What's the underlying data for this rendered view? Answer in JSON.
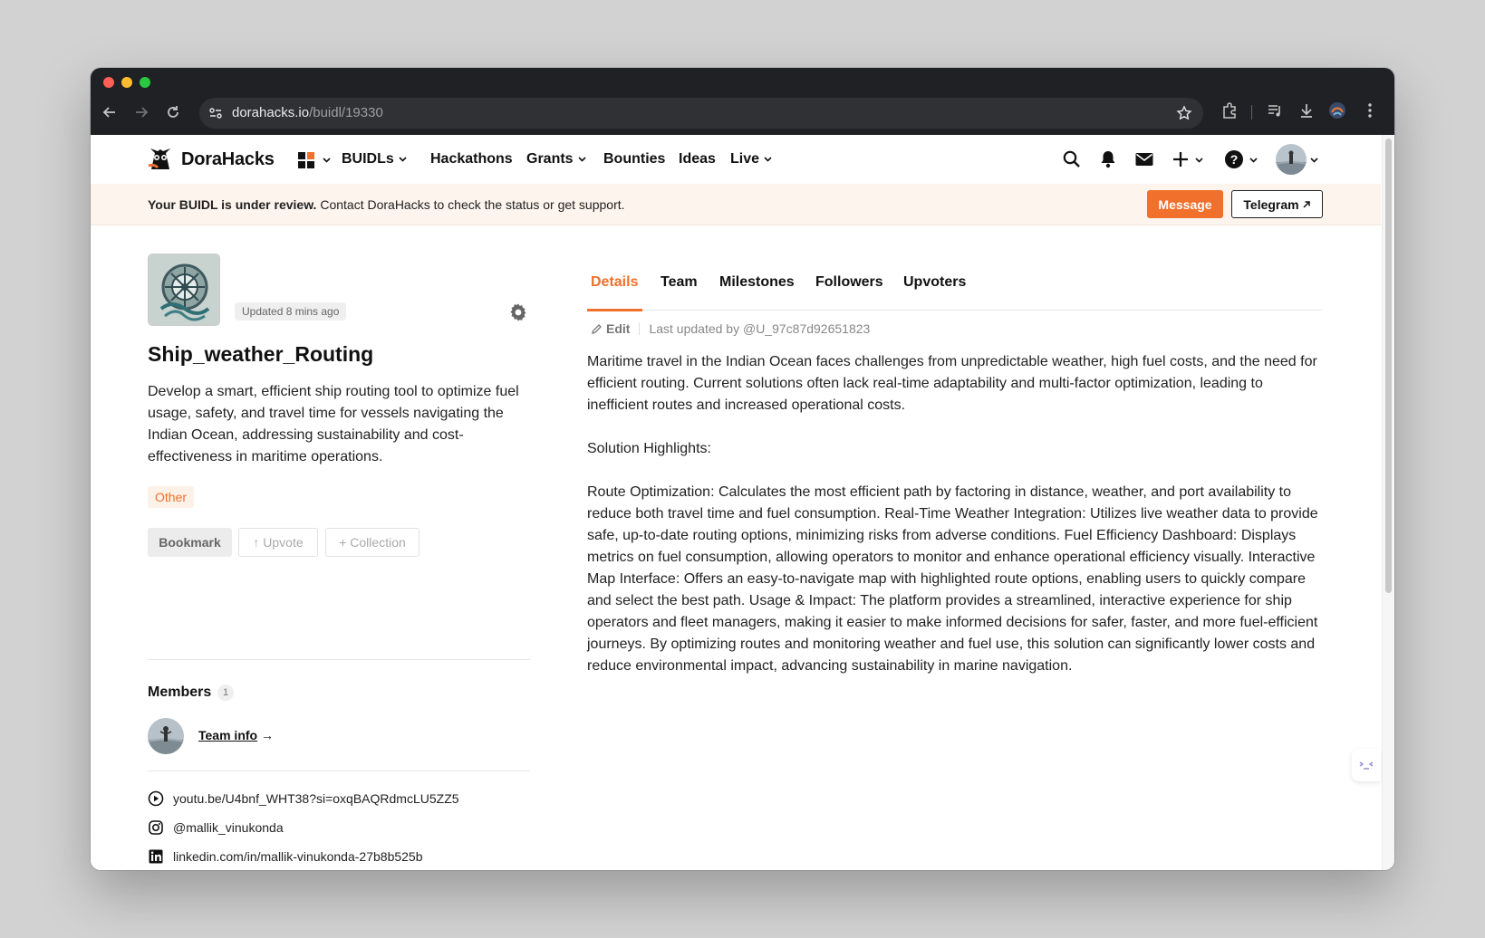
{
  "browser": {
    "url_host": "dorahacks.io",
    "url_path": "/buidl/19330"
  },
  "nav": {
    "brand": "DoraHacks",
    "buidls": "BUIDLs",
    "hackathons": "Hackathons",
    "grants": "Grants",
    "bounties": "Bounties",
    "ideas": "Ideas",
    "live": "Live"
  },
  "banner": {
    "bold": "Your BUIDL is under review.",
    "text": " Contact DoraHacks to check the status or get support.",
    "message_btn": "Message",
    "telegram_btn": "Telegram"
  },
  "project": {
    "updated": "Updated 8 mins ago",
    "title": "Ship_weather_Routing",
    "description": "Develop a smart, efficient ship routing tool to optimize fuel usage, safety, and travel time for vessels navigating the Indian Ocean, addressing sustainability and cost-effectiveness in maritime operations.",
    "tag": "Other",
    "bookmark": "Bookmark",
    "upvote": "↑ Upvote",
    "collection": "+ Collection"
  },
  "members": {
    "heading": "Members",
    "count": "1",
    "team_info": "Team info",
    "arrow": "→"
  },
  "links": {
    "youtube": "youtu.be/U4bnf_WHT38?si=oxqBAQRdmcLU5ZZ5",
    "instagram": "@mallik_vinukonda",
    "linkedin": "linkedin.com/in/mallik-vinukonda-27b8b525b"
  },
  "tabs": {
    "details": "Details",
    "team": "Team",
    "milestones": "Milestones",
    "followers": "Followers",
    "upvoters": "Upvoters"
  },
  "details": {
    "edit": "Edit",
    "last_updated": "Last updated by @U_97c87d92651823",
    "para1": "Maritime travel in the Indian Ocean faces challenges from unpredictable weather, high fuel costs, and the need for efficient routing. Current solutions often lack real-time adaptability and multi-factor optimization, leading to inefficient routes and increased operational costs.",
    "para2": "Solution Highlights:",
    "para3": "Route Optimization: Calculates the most efficient path by factoring in distance, weather, and port availability to reduce both travel time and fuel consumption. Real-Time Weather Integration: Utilizes live weather data to provide safe, up-to-date routing options, minimizing risks from adverse conditions. Fuel Efficiency Dashboard: Displays metrics on fuel consumption, allowing operators to monitor and enhance operational efficiency visually. Interactive Map Interface: Offers an easy-to-navigate map with highlighted route options, enabling users to quickly compare and select the best path. Usage & Impact: The platform provides a streamlined, interactive experience for ship operators and fleet managers, making it easier to make informed decisions for safer, faster, and more fuel-efficient journeys. By optimizing routes and monitoring weather and fuel use, this solution can significantly lower costs and reduce environmental impact, advancing sustainability in marine navigation."
  },
  "colors": {
    "accent": "#f0702c",
    "banner_bg": "#fdf4ed",
    "chrome_bg": "#202124"
  },
  "icons": [
    "back-icon",
    "forward-icon",
    "reload-icon",
    "site-settings-icon",
    "star-icon",
    "extensions-icon",
    "media-icon",
    "download-icon",
    "profile-icon",
    "menu-icon",
    "search-icon",
    "bell-icon",
    "mail-icon",
    "plus-icon",
    "help-icon",
    "gear-icon",
    "play-icon",
    "instagram-icon",
    "linkedin-icon",
    "share-icon"
  ]
}
